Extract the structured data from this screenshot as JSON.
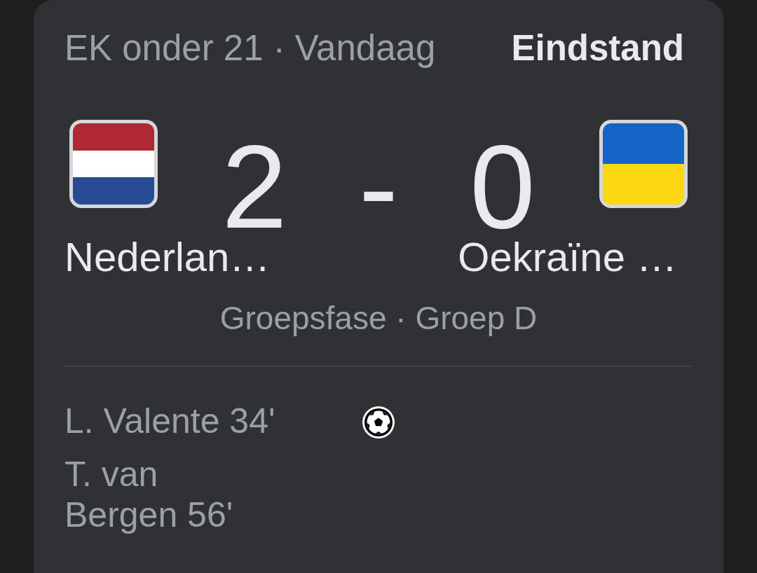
{
  "header": {
    "competition": "EK onder 21 · Vandaag",
    "status": "Eindstand"
  },
  "score": {
    "home": "2",
    "separator": "-",
    "away": "0"
  },
  "teams": {
    "home": "Nederlan…",
    "away": "Oekraïne …"
  },
  "stage": "Groepsfase · Groep D",
  "goals": {
    "home": [
      "L. Valente 34'",
      "T. van Bergen 56'"
    ]
  }
}
